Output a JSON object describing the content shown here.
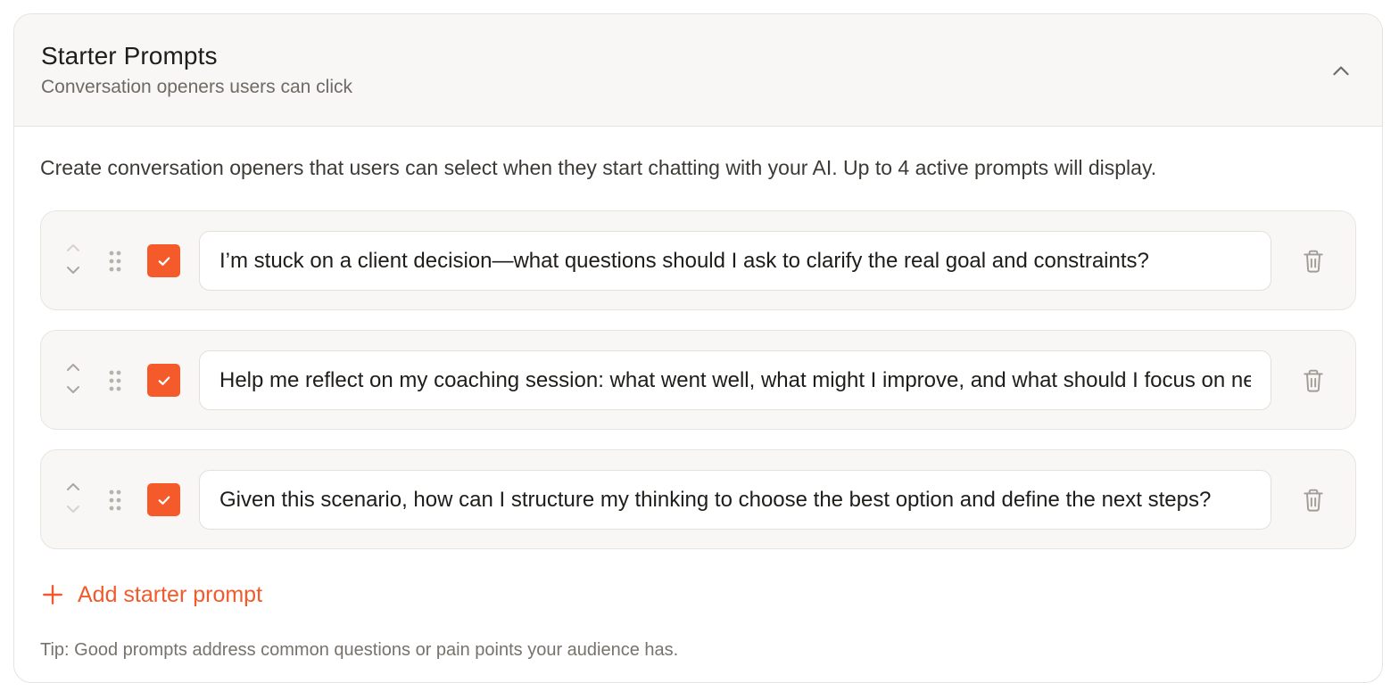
{
  "header": {
    "title": "Starter Prompts",
    "subtitle": "Conversation openers users can click"
  },
  "body": {
    "description": "Create conversation openers that users can select when they start chatting with your AI. Up to 4 active prompts will display.",
    "prompts": [
      {
        "checked": true,
        "value": "I’m stuck on a client decision—what questions should I ask to clarify the real goal and constraints?"
      },
      {
        "checked": true,
        "value": "Help me reflect on my coaching session: what went well, what might I improve, and what should I focus on next?"
      },
      {
        "checked": true,
        "value": "Given this scenario, how can I structure my thinking to choose the best option and define the next steps?"
      }
    ],
    "add_label": "Add starter prompt",
    "tip": "Tip: Good prompts address common questions or pain points your audience has."
  },
  "colors": {
    "accent": "#f45a2a",
    "header_bg": "#f8f7f5",
    "row_bg": "#f8f7f5",
    "border": "#e6e3de",
    "muted_text": "#6e6a64"
  },
  "icons": {
    "collapse": "chevron-up-icon",
    "move_up": "chevron-up-icon",
    "move_down": "chevron-down-icon",
    "drag": "drag-handle-icon",
    "check": "check-icon",
    "delete": "trash-icon",
    "add": "plus-icon"
  }
}
